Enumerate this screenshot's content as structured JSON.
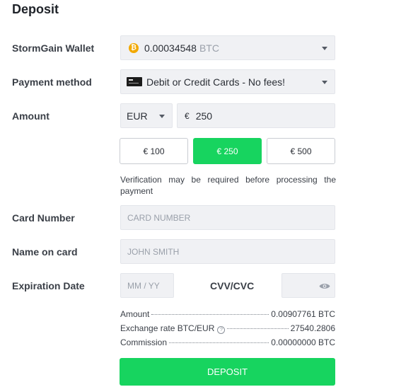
{
  "title": "Deposit",
  "wallet": {
    "label": "StormGain Wallet",
    "amount": "0.00034548",
    "currency": "BTC",
    "icon": "bitcoin-icon"
  },
  "payment": {
    "label": "Payment method",
    "value": "Debit or Credit Cards - No fees!",
    "icon": "credit-card-icon"
  },
  "amount": {
    "label": "Amount",
    "currency": "EUR",
    "symbol": "€",
    "value": "250"
  },
  "presets": [
    {
      "label": "€ 100",
      "active": false
    },
    {
      "label": "€ 250",
      "active": true
    },
    {
      "label": "€ 500",
      "active": false
    }
  ],
  "note": "Verification may be required before processing the payment",
  "card_number": {
    "label": "Card Number",
    "placeholder": "CARD NUMBER"
  },
  "name_on_card": {
    "label": "Name on card",
    "placeholder": "JOHN SMITH"
  },
  "expiration": {
    "label": "Expiration Date",
    "placeholder": "MM / YY"
  },
  "cvv": {
    "label": "CVV/CVC",
    "icon": "eye-icon"
  },
  "summary": {
    "amount_label": "Amount",
    "amount_value": "0.00907761 BTC",
    "rate_label": "Exchange rate BTC/EUR",
    "rate_value": "27540.2806",
    "commission_label": "Commission",
    "commission_value": "0.00000000 BTC"
  },
  "deposit_button": "DEPOSIT",
  "colors": {
    "accent": "#17d45f",
    "field_bg": "#f0f1f4",
    "btc": "#f2a900"
  }
}
